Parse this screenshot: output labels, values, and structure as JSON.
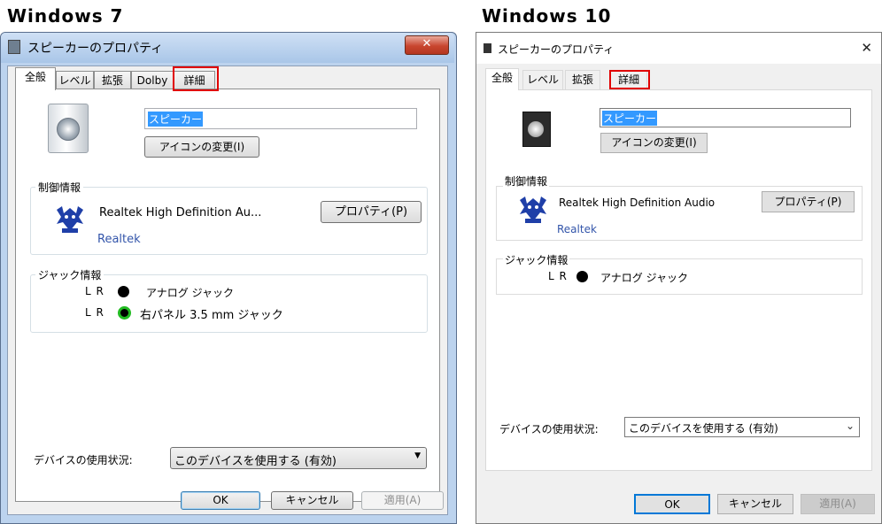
{
  "headings": {
    "left": "Windows 7",
    "right": "Windows 10"
  },
  "window": {
    "title": "スピーカーのプロパティ",
    "close_glyph": "✕"
  },
  "tabs": [
    "全般",
    "レベル",
    "拡張",
    "Dolby",
    "詳細"
  ],
  "tabs_win10": [
    "全般",
    "レベル",
    "拡張",
    "詳細"
  ],
  "device": {
    "name_value": "スピーカー",
    "change_icon_button": "アイコンの変更(I)"
  },
  "controller": {
    "group_label": "制御情報",
    "name_win7": "Realtek High Definition Au...",
    "name_win10": "Realtek High Definition Audio",
    "vendor_link": "Realtek",
    "properties_button": "プロパティ(P)"
  },
  "jack": {
    "group_label": "ジャック情報",
    "items_win7": [
      {
        "lr": "L R",
        "label": "アナログ ジャック",
        "color": "#000000"
      },
      {
        "lr": "L R",
        "label": "右パネル 3.5 mm ジャック",
        "color": "#22bb22"
      }
    ],
    "items_win10": [
      {
        "lr": "L R",
        "label": "アナログ ジャック",
        "color": "#000000"
      }
    ]
  },
  "usage": {
    "label": "デバイスの使用状況:",
    "selected": "このデバイスを使用する (有効)"
  },
  "footer": {
    "ok": "OK",
    "cancel": "キャンセル",
    "apply": "適用(A)"
  },
  "colors": {
    "highlight": "#e00000",
    "link": "#3355aa",
    "win7_frame": "#bcd3ee"
  }
}
